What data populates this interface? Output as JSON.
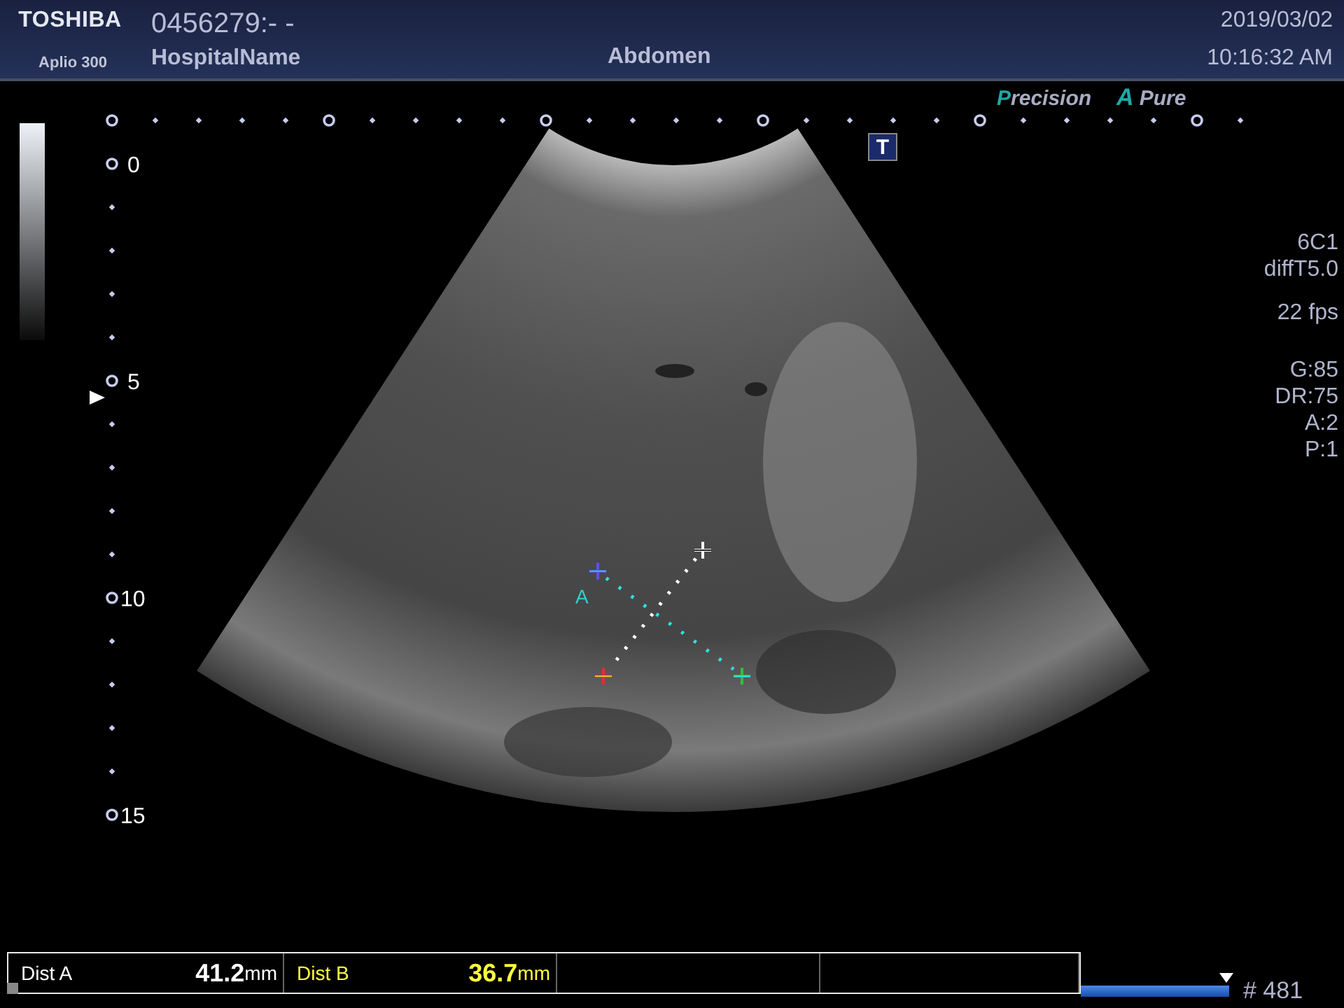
{
  "header": {
    "brand": "TOSHIBA",
    "model": "Aplio 300",
    "patient_id": "0456279:- -",
    "hospital": "HospitalName",
    "exam": "Abdomen",
    "date": "2019/03/02",
    "time": "10:16:32 AM"
  },
  "mode_labels": {
    "precision": "Precision",
    "apure_mark": "A",
    "apure": "Pure"
  },
  "t_badge": "T",
  "depth_labels": [
    "0",
    "5",
    "10",
    "15"
  ],
  "caliper_label": "A",
  "info_groups": [
    [
      "6C1",
      "diffT5.0"
    ],
    [
      "22 fps"
    ],
    [
      "G:85",
      "DR:75",
      "A:2",
      "P:1"
    ]
  ],
  "measurements": [
    {
      "label": "Dist A",
      "value": "41.2",
      "unit": "mm",
      "color": "#ffffff"
    },
    {
      "label": "Dist B",
      "value": "36.7",
      "unit": "mm",
      "color": "#ffff40"
    }
  ],
  "cine": {
    "level": 1,
    "frame": "# 481"
  }
}
